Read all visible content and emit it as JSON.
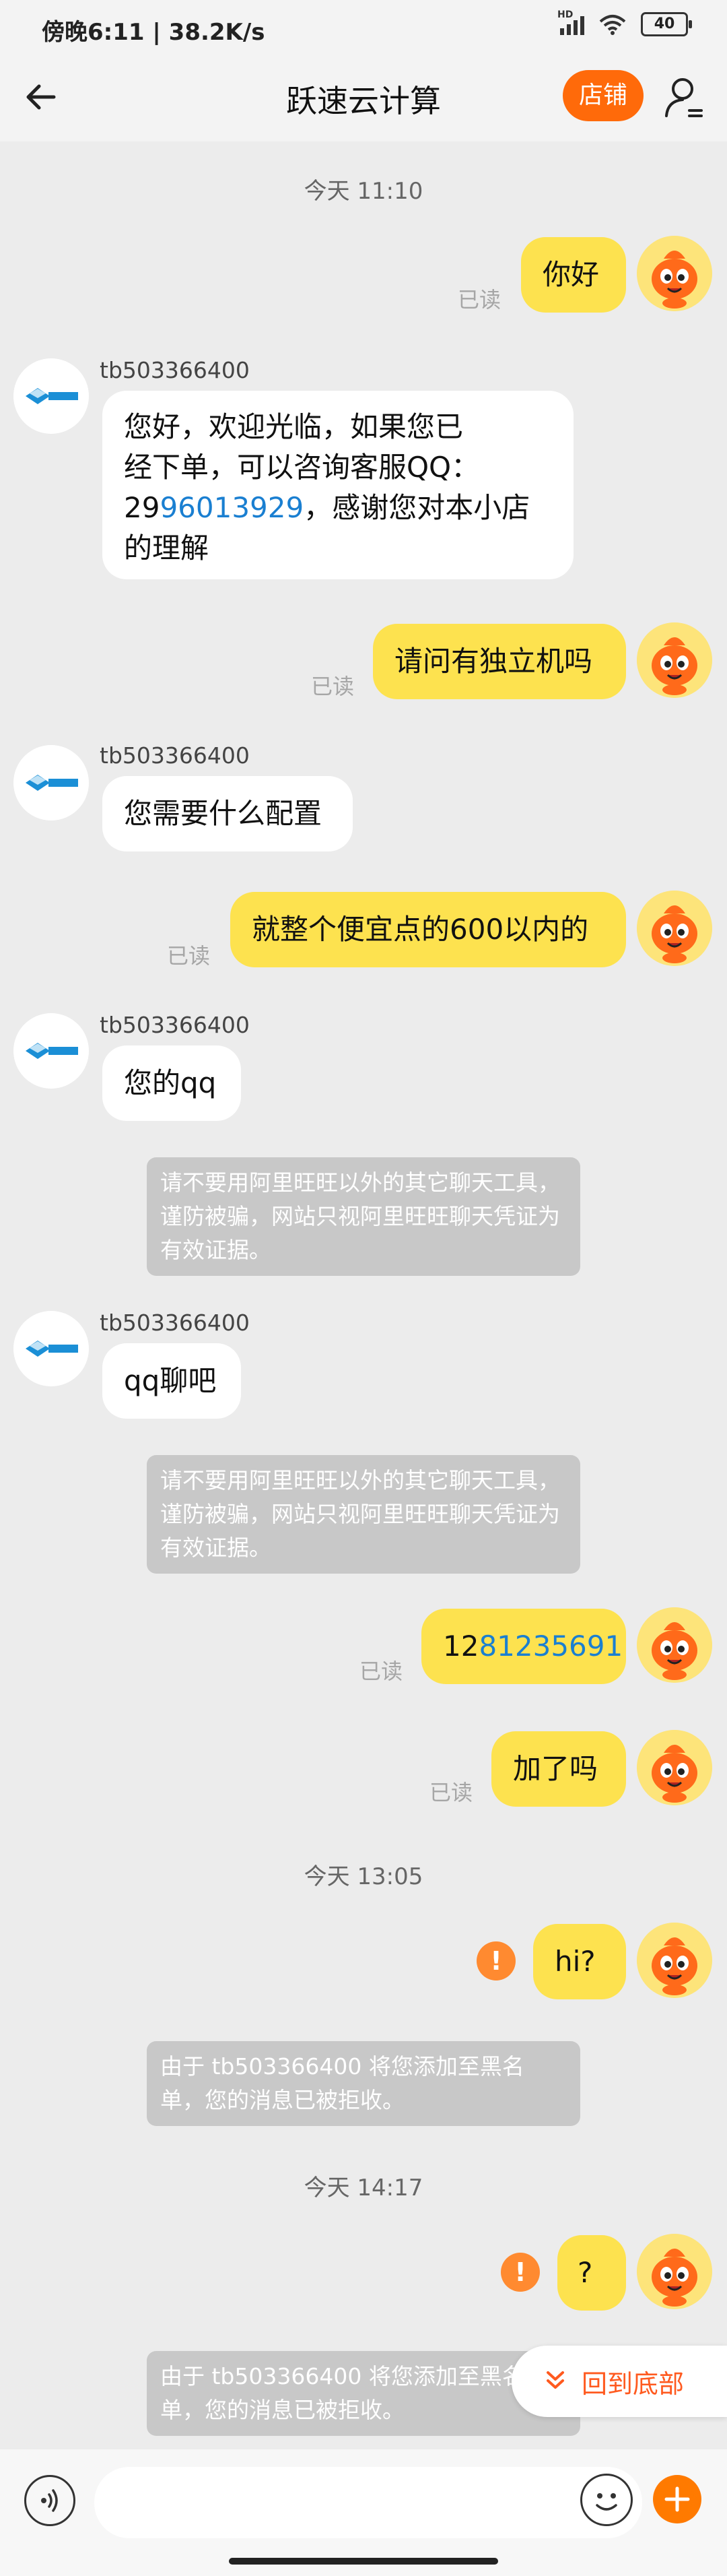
{
  "status": {
    "left": "傍晚6:11 | 38.2K/s",
    "hd": "HD",
    "battery": "40"
  },
  "header": {
    "title": "跃速云计算",
    "shop_button": "店铺"
  },
  "messages": {
    "t1": "今天  11:10",
    "m1": "你好",
    "read": "已读",
    "sender": "tb503366400",
    "s1_line1": "您好，欢迎光临，如果您已",
    "s1_line2": "经下单，可以咨询客服QQ：",
    "s1_qq_prefix": "29",
    "s1_qq_link": "96013929",
    "s1_line3_rest": "，感谢您对本小店",
    "s1_line4": "的理解",
    "m2": "请问有独立机吗",
    "s2": "您需要什么配置",
    "m3": "就整个便宜点的600以内的",
    "s3": "您的qq",
    "notice": "请不要用阿里旺旺以外的其它聊天工具，谨防被骗，网站只视阿里旺旺聊天凭证为有效证据。",
    "s4": "qq聊吧",
    "m4_prefix": "12",
    "m4_link": "81235691",
    "m5": "加了吗",
    "t2": "今天  13:05",
    "m6": "hi?",
    "blocked": "由于 tb503366400 将您添加至黑名单，您的消息已被拒收。",
    "t3": "今天  14:17",
    "m7": "?",
    "error_mark": "!"
  },
  "back_to_bottom": "回到底部",
  "colors": {
    "accent": "#ff6a0a",
    "my_bubble": "#fde24f",
    "link": "#1a7fd1"
  }
}
